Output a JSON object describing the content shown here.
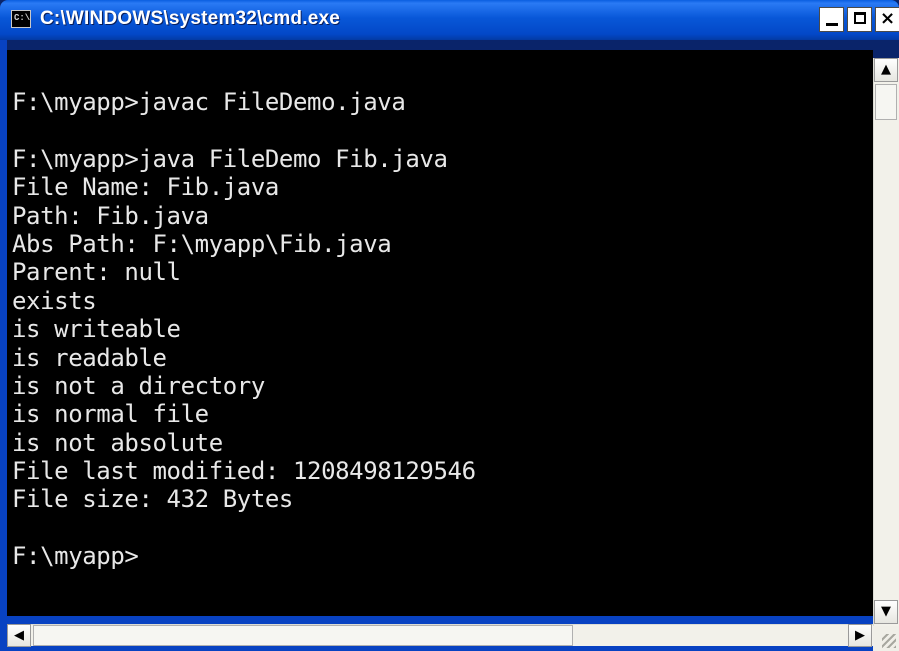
{
  "window": {
    "title": "C:\\WINDOWS\\system32\\cmd.exe",
    "icon_label": "C:\\",
    "controls": {
      "minimize": "minimize-icon",
      "maximize": "maximize-icon",
      "close": "×"
    }
  },
  "console": {
    "lines": [
      "",
      "F:\\myapp>javac FileDemo.java",
      "",
      "F:\\myapp>java FileDemo Fib.java",
      "File Name: Fib.java",
      "Path: Fib.java",
      "Abs Path: F:\\myapp\\Fib.java",
      "Parent: null",
      "exists",
      "is writeable",
      "is readable",
      "is not a directory",
      "is normal file",
      "is not absolute",
      "File last modified: 1208498129546",
      "File size: 432 Bytes",
      "",
      "F:\\myapp>"
    ]
  },
  "scrollbars": {
    "up_arrow": "▲",
    "down_arrow": "▼",
    "left_arrow": "◀",
    "right_arrow": "▶"
  },
  "colors": {
    "titlebar": "#0857d8",
    "console_bg": "#000000",
    "console_text": "#e8e8e8"
  }
}
